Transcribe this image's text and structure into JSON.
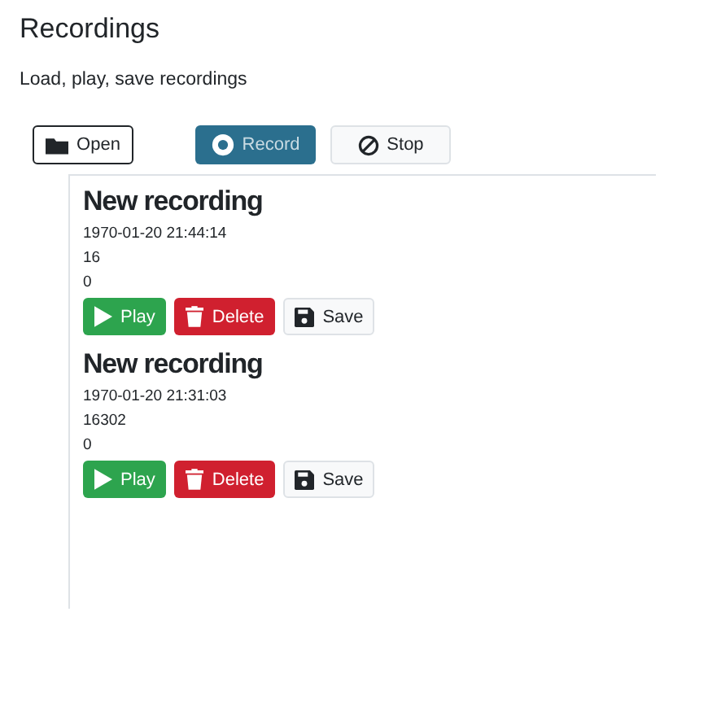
{
  "title": "Recordings",
  "subtitle": "Load, play, save recordings",
  "toolbar": [
    {
      "kind": "open",
      "label": "Open"
    },
    {
      "kind": "record",
      "label": "Record"
    },
    {
      "kind": "stop",
      "label": "Stop"
    }
  ],
  "recordings": [
    {
      "name": "New recording",
      "date": "1970-01-20 21:44:14",
      "size": "16",
      "value": "0",
      "buttons": [
        {
          "kind": "play",
          "label": "Play"
        },
        {
          "kind": "delete",
          "label": "Delete"
        },
        {
          "kind": "save",
          "label": "Save"
        }
      ]
    },
    {
      "name": "New recording",
      "date": "1970-01-20 21:31:03",
      "size": "16302",
      "value": "0",
      "buttons": [
        {
          "kind": "play",
          "label": "Play"
        },
        {
          "kind": "delete",
          "label": "Delete"
        },
        {
          "kind": "save",
          "label": "Save"
        }
      ]
    }
  ]
}
